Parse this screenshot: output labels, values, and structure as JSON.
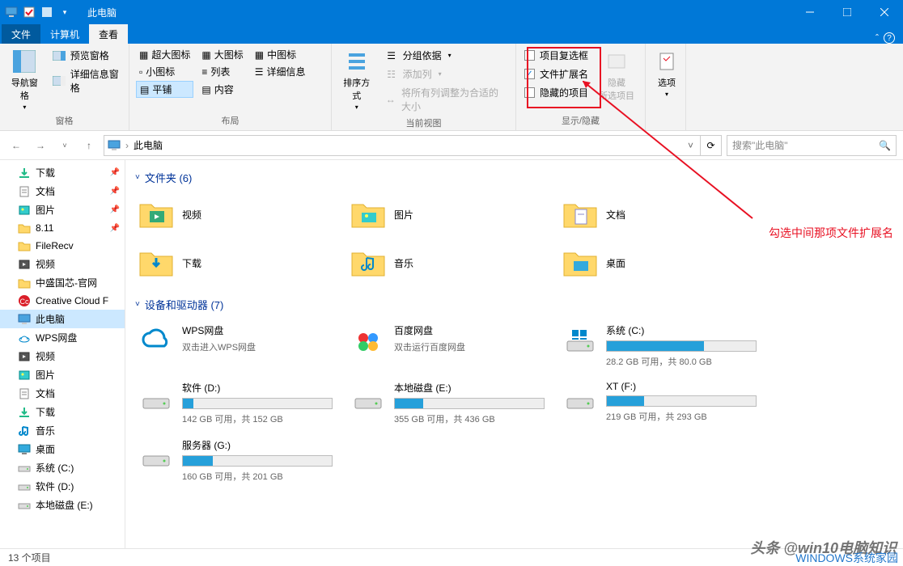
{
  "title": "此电脑",
  "tabs": {
    "file": "文件",
    "computer": "计算机",
    "view": "查看"
  },
  "ribbon": {
    "panes": {
      "label": "窗格",
      "nav": "导航窗格",
      "preview": "预览窗格",
      "details": "详细信息窗格"
    },
    "layout": {
      "label": "布局",
      "xl": "超大图标",
      "lg": "大图标",
      "md": "中图标",
      "sm": "小图标",
      "list": "列表",
      "det": "详细信息",
      "tile": "平铺",
      "content": "内容"
    },
    "curview": {
      "label": "当前视图",
      "sort": "排序方式",
      "group": "分组依据",
      "addcol": "添加列",
      "fitall": "将所有列调整为合适的大小"
    },
    "showhide": {
      "label": "显示/隐藏",
      "itemchk": "项目复选框",
      "ext": "文件扩展名",
      "hidden": "隐藏的项目",
      "hidebtn": "隐藏\n所选项目"
    },
    "options": "选项"
  },
  "addr": {
    "path": "此电脑"
  },
  "search": {
    "placeholder": "搜索\"此电脑\""
  },
  "sidebar": {
    "items": [
      {
        "label": "下载",
        "pin": true
      },
      {
        "label": "文档",
        "pin": true
      },
      {
        "label": "图片",
        "pin": true
      },
      {
        "label": "8.11",
        "pin": true
      },
      {
        "label": "FileRecv"
      },
      {
        "label": "视频"
      },
      {
        "label": "中盛国芯-官网"
      },
      {
        "label": "Creative Cloud F"
      },
      {
        "label": "此电脑",
        "selected": true
      },
      {
        "label": "WPS网盘"
      },
      {
        "label": "视频"
      },
      {
        "label": "图片"
      },
      {
        "label": "文档"
      },
      {
        "label": "下载"
      },
      {
        "label": "音乐"
      },
      {
        "label": "桌面"
      },
      {
        "label": "系统 (C:)"
      },
      {
        "label": "软件 (D:)"
      },
      {
        "label": "本地磁盘 (E:)"
      }
    ]
  },
  "content": {
    "folders_hdr": "文件夹 (6)",
    "folders": [
      {
        "name": "视频"
      },
      {
        "name": "图片"
      },
      {
        "name": "文档"
      },
      {
        "name": "下载"
      },
      {
        "name": "音乐"
      },
      {
        "name": "桌面"
      }
    ],
    "devices_hdr": "设备和驱动器 (7)",
    "clouds": [
      {
        "name": "WPS网盘",
        "sub": "双击进入WPS网盘"
      },
      {
        "name": "百度网盘",
        "sub": "双击运行百度网盘"
      }
    ],
    "drives": [
      {
        "name": "系统 (C:)",
        "sub": "28.2 GB 可用，共 80.0 GB",
        "pct": 65
      },
      {
        "name": "软件 (D:)",
        "sub": "142 GB 可用，共 152 GB",
        "pct": 7
      },
      {
        "name": "本地磁盘 (E:)",
        "sub": "355 GB 可用，共 436 GB",
        "pct": 19
      },
      {
        "name": "XT (F:)",
        "sub": "219 GB 可用，共 293 GB",
        "pct": 25
      },
      {
        "name": "服务器 (G:)",
        "sub": "160 GB 可用，共 201 GB",
        "pct": 20
      }
    ]
  },
  "status": "13 个项目",
  "annotation": "勾选中间那项文件扩展名",
  "watermark1": "头条 @win10电脑知识",
  "watermark2": "WINDOWS系统家园"
}
